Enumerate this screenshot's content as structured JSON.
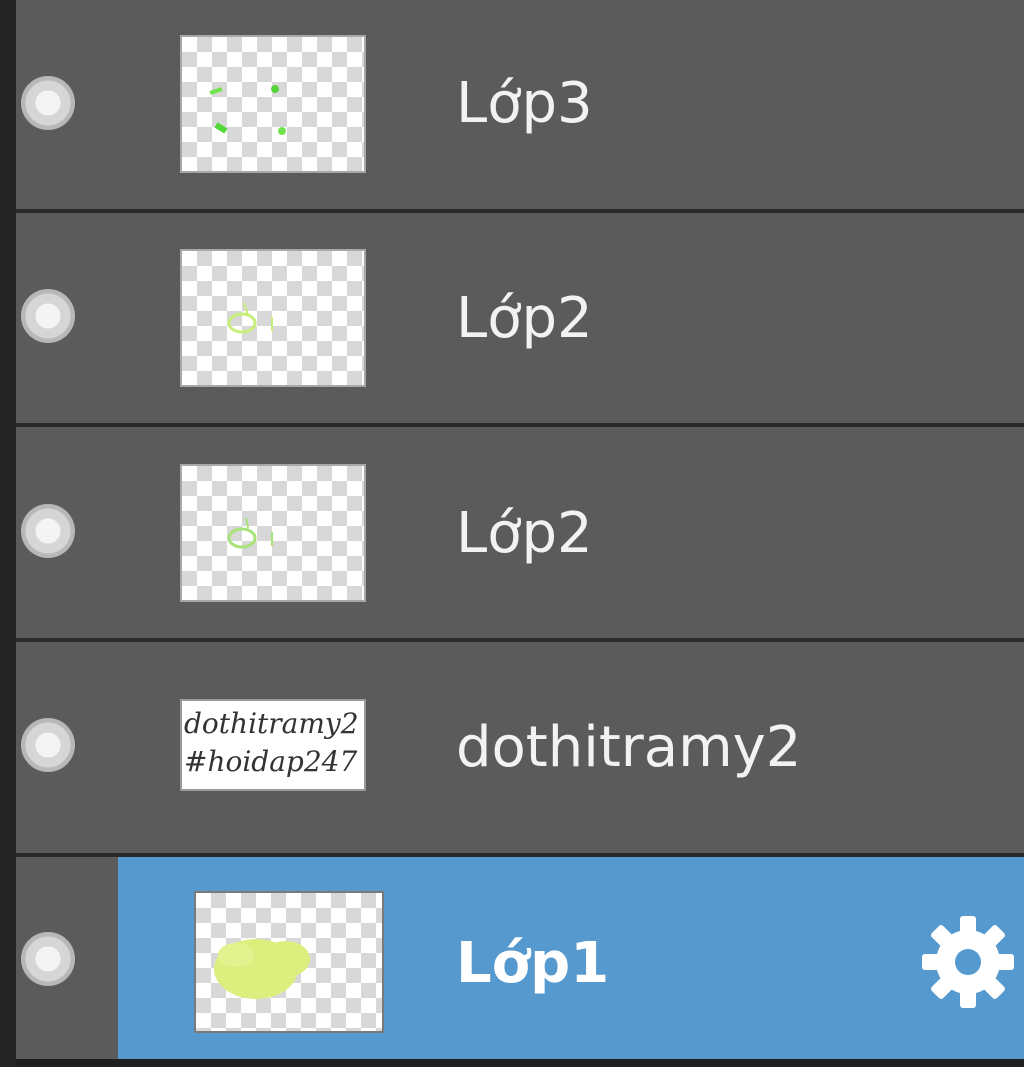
{
  "layers": [
    {
      "name": "Lớp3",
      "selected": false,
      "thumbnail": "transparent-green-dots"
    },
    {
      "name": "Lớp2",
      "selected": false,
      "thumbnail": "transparent-green-scribble"
    },
    {
      "name": "Lớp2",
      "selected": false,
      "thumbnail": "transparent-green-scribble"
    },
    {
      "name": "dothitramy2",
      "selected": false,
      "thumbnail": "text",
      "thumb_lines": [
        "dothitramy2",
        "#hoidap247"
      ]
    },
    {
      "name": "Lớp1",
      "selected": true,
      "thumbnail": "transparent-yellow-blob"
    }
  ],
  "icons": {
    "visibility": "radio-dot-icon",
    "settings": "gear-icon"
  },
  "colors": {
    "selected_background": "#5599cf",
    "row_background": "#5b5b5b"
  }
}
